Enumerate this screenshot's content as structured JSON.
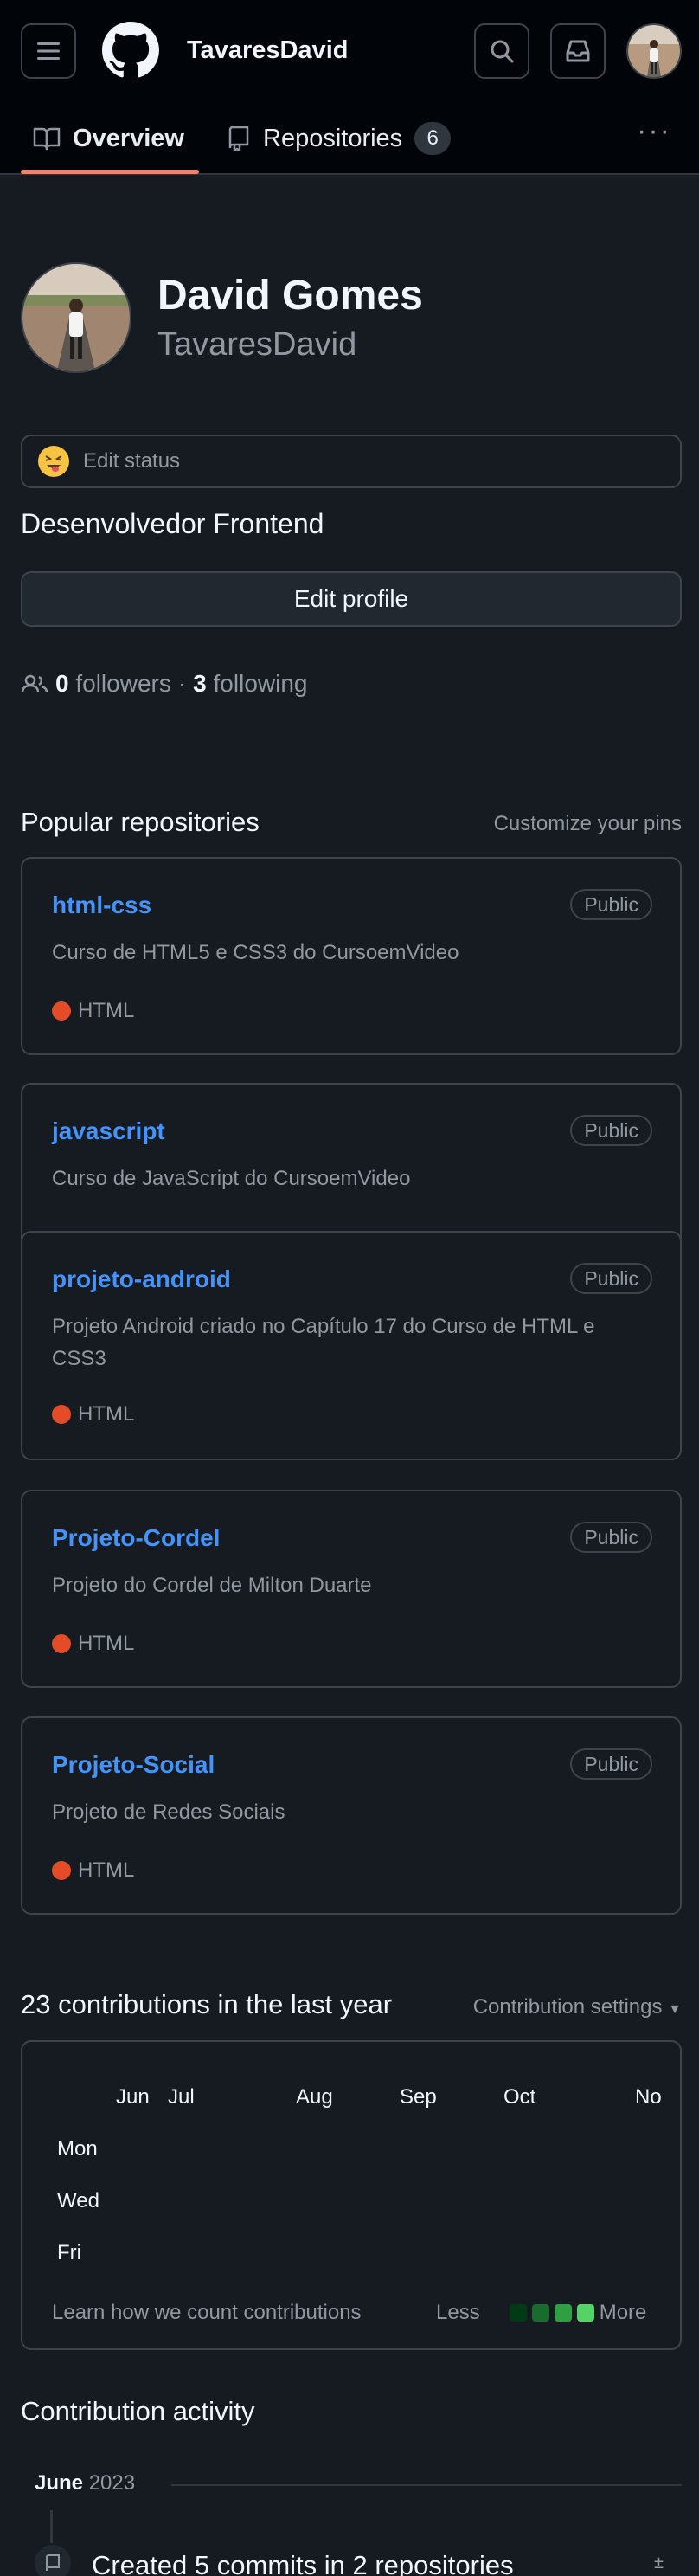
{
  "header": {
    "username": "TavaresDavid"
  },
  "tabs": {
    "overview": "Overview",
    "repositories": "Repositories",
    "repositories_count": "6"
  },
  "profile": {
    "full_name": "David Gomes",
    "login": "TavaresDavid",
    "status_placeholder": "Edit status",
    "bio": "Desenvolvedor Frontend",
    "edit_button": "Edit profile",
    "followers_count": "0",
    "followers_label": "followers",
    "separator": "·",
    "following_count": "3",
    "following_label": "following"
  },
  "popular": {
    "title": "Popular repositories",
    "customize": "Customize your pins",
    "repos": [
      {
        "name": "html-css",
        "visibility": "Public",
        "description": "Curso de HTML5 e CSS3 do CursoemVideo",
        "language": "HTML",
        "language_color": "#e34c26"
      },
      {
        "name": "javascript",
        "visibility": "Public",
        "description": "Curso de JavaScript do CursoemVideo"
      },
      {
        "name": "projeto-android",
        "visibility": "Public",
        "description": "Projeto Android criado no Capítulo 17 do Curso de HTML e CSS3",
        "language": "HTML",
        "language_color": "#e34c26"
      },
      {
        "name": "Projeto-Cordel",
        "visibility": "Public",
        "description": "Projeto do Cordel de Milton Duarte",
        "language": "HTML",
        "language_color": "#e34c26"
      },
      {
        "name": "Projeto-Social",
        "visibility": "Public",
        "description": "Projeto de Redes Sociais",
        "language": "HTML",
        "language_color": "#e34c26"
      }
    ]
  },
  "contributions": {
    "title": "23 contributions in the last year",
    "settings": "Contribution settings",
    "months": [
      "Jun",
      "Jul",
      "Aug",
      "Sep",
      "Oct",
      "No"
    ],
    "days": [
      "Mon",
      "Wed",
      "Fri"
    ],
    "learn": "Learn how we count contributions",
    "less": "Less",
    "more": "More",
    "legend_colors": [
      "#161b22",
      "#033a16",
      "#196c2e",
      "#2ea043",
      "#56d364"
    ]
  },
  "activity": {
    "title": "Contribution activity",
    "month": "June",
    "year": "2023",
    "event": "Created 5 commits in 2 repositories"
  }
}
